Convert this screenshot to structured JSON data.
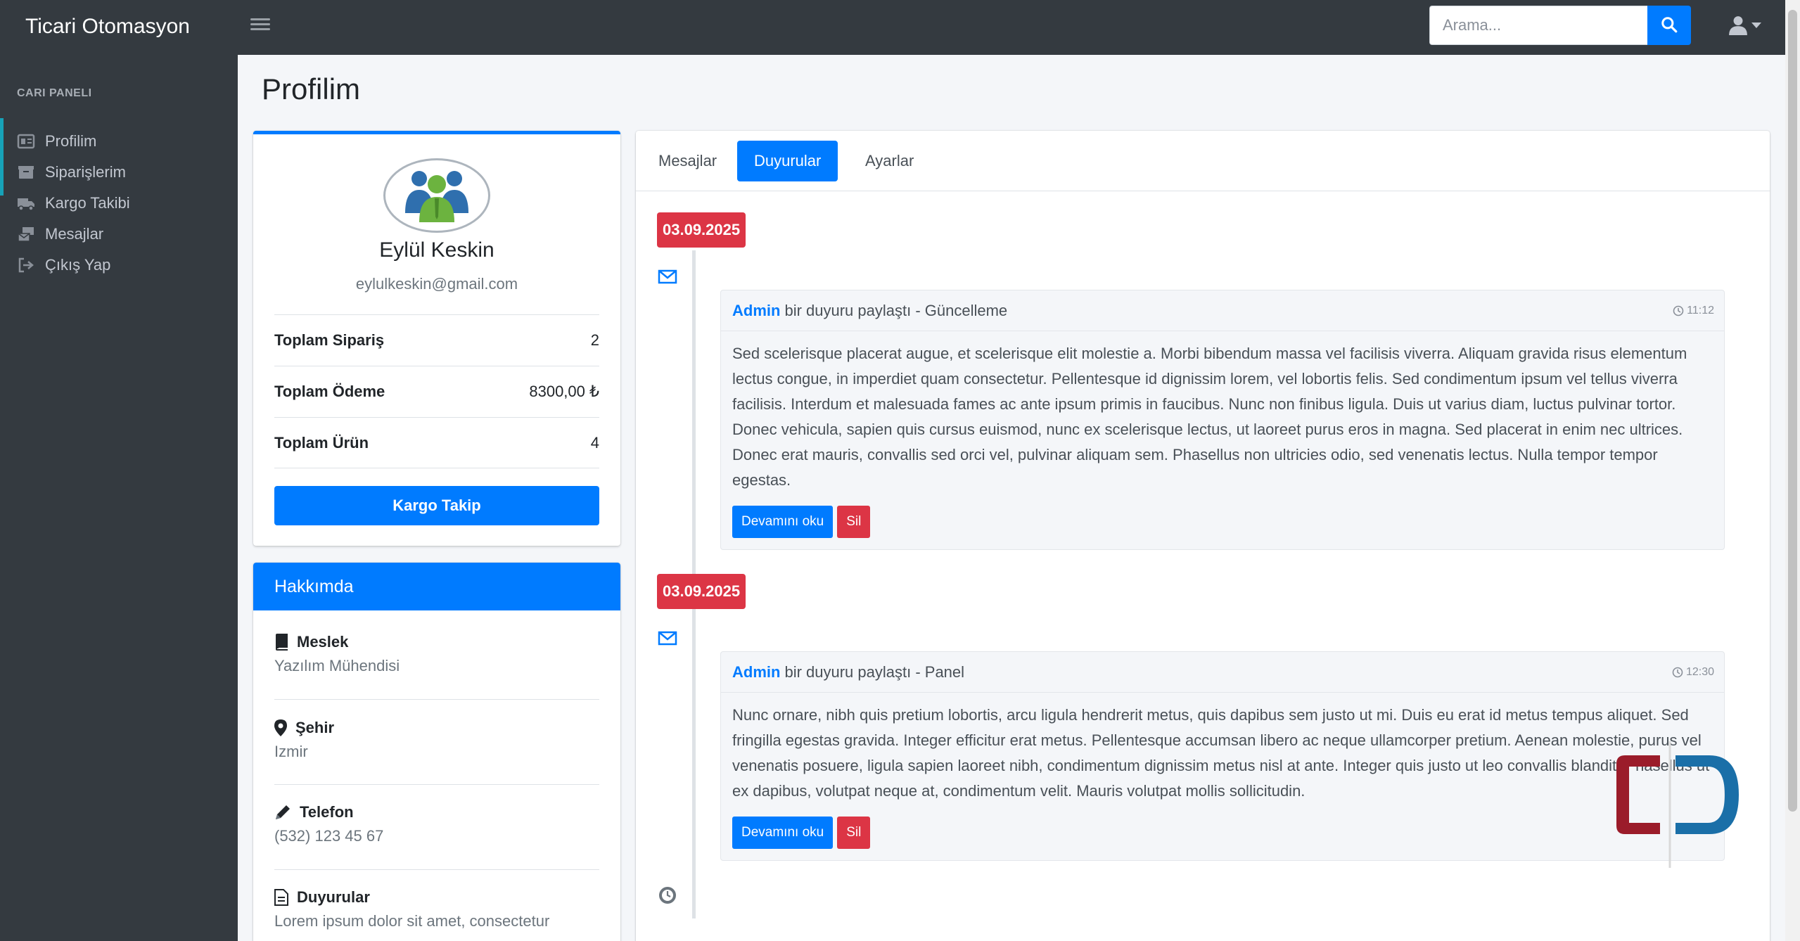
{
  "app": {
    "brand": "Ticari Otomasyon"
  },
  "search": {
    "placeholder": "Arama..."
  },
  "sidebar": {
    "header": "CARI PANELI",
    "items": [
      {
        "label": "Profilim",
        "icon": "id-card-icon",
        "active": true
      },
      {
        "label": "Siparişlerim",
        "icon": "box-icon",
        "active": true
      },
      {
        "label": "Kargo Takibi",
        "icon": "truck-icon",
        "active": false
      },
      {
        "label": "Mesajlar",
        "icon": "mail-bulk-icon",
        "active": false
      },
      {
        "label": "Çıkış Yap",
        "icon": "sign-out-icon",
        "active": false
      }
    ]
  },
  "page": {
    "title": "Profilim"
  },
  "profile": {
    "name": "Eylül Keskin",
    "email": "eylulkeskin@gmail.com",
    "stats": [
      {
        "label": "Toplam Sipariş",
        "value": "2"
      },
      {
        "label": "Toplam Ödeme",
        "value": "8300,00 ₺"
      },
      {
        "label": "Toplam Ürün",
        "value": "4"
      }
    ],
    "button": "Kargo Takip"
  },
  "about": {
    "title": "Hakkımda",
    "items": [
      {
        "label": "Meslek",
        "value": "Yazılım Mühendisi",
        "icon": "book-icon"
      },
      {
        "label": "Şehir",
        "value": "Izmir",
        "icon": "map-marker-icon"
      },
      {
        "label": "Telefon",
        "value": "(532) 123 45 67",
        "icon": "pencil-icon"
      },
      {
        "label": "Duyurular",
        "value": "Lorem ipsum dolor sit amet, consectetur",
        "icon": "file-text-icon"
      }
    ]
  },
  "tabs": [
    {
      "label": "Mesajlar",
      "active": false
    },
    {
      "label": "Duyurular",
      "active": true
    },
    {
      "label": "Ayarlar",
      "active": false
    }
  ],
  "timeline": [
    {
      "date": "03.09.2025",
      "author": "Admin",
      "action": "bir duyuru paylaştı - Güncelleme",
      "time": "11:12",
      "body": "Sed scelerisque placerat augue, et scelerisque elit molestie a. Morbi bibendum massa vel facilisis viverra. Aliquam gravida risus elementum lectus congue, in imperdiet quam consectetur. Pellentesque id dignissim lorem, vel lobortis felis. Sed condimentum ipsum vel tellus viverra facilisis. Interdum et malesuada fames ac ante ipsum primis in faucibus. Nunc non finibus ligula. Duis ut varius diam, luctus pulvinar tortor. Donec vehicula, sapien quis cursus euismod, nunc ex scelerisque lectus, ut laoreet purus eros in magna. Sed placerat in enim nec ultrices. Donec erat mauris, convallis sed orci vel, pulvinar aliquam sem. Phasellus non ultricies odio, sed venenatis lectus. Nulla tempor tempor egestas.",
      "read_more": "Devamını oku",
      "delete": "Sil"
    },
    {
      "date": "03.09.2025",
      "author": "Admin",
      "action": "bir duyuru paylaştı - Panel",
      "time": "12:30",
      "body": "Nunc ornare, nibh quis pretium lobortis, arcu ligula hendrerit metus, quis dapibus sem justo ut mi. Duis eu erat id metus tempus aliquet. Sed fringilla egestas gravida. Integer efficitur erat metus. Pellentesque accumsan libero ac neque ullamcorper pretium. Aenean molestie, purus vel venenatis posuere, ligula sapien laoreet nibh, condimentum dignissim metus nisl at ante. Integer quis justo ut leo convallis blandit. Phasellus ut ex dapibus, volutpat neque at, condimentum velit. Mauris volutpat mollis sollicitudin.",
      "read_more": "Devamını oku",
      "delete": "Sil"
    }
  ],
  "colors": {
    "primary": "#007bff",
    "danger": "#dc3545",
    "sidebar": "#343a40",
    "accent": "#17a2b8"
  }
}
